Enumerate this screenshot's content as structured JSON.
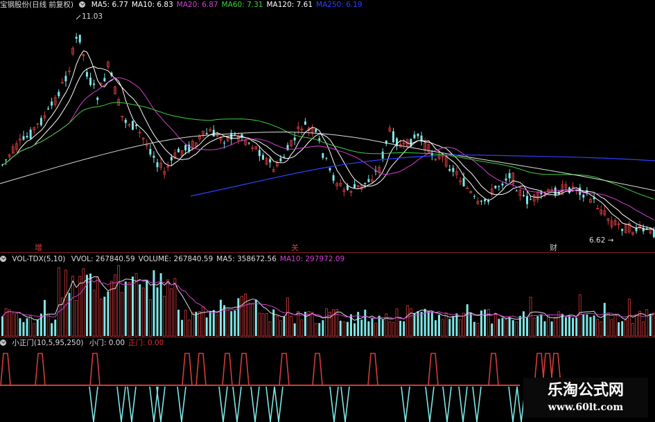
{
  "main_legend": {
    "title": "宝钢股份(日线 前复权)",
    "ma": [
      {
        "label": "MA5: 6.77",
        "color": "#ffffff"
      },
      {
        "label": "MA10: 6.83",
        "color": "#ffffff"
      },
      {
        "label": "MA20: 6.87",
        "color": "#d040d0"
      },
      {
        "label": "MA60: 7.31",
        "color": "#40d040"
      },
      {
        "label": "MA120: 7.61",
        "color": "#ffffff"
      },
      {
        "label": "MA250: 6.19",
        "color": "#3040ff"
      }
    ]
  },
  "price_high_label": "11.03",
  "price_low_label": "6.62",
  "markers": [
    {
      "text": "增",
      "color": "#d24040"
    },
    {
      "text": "关",
      "color": "#d24040"
    },
    {
      "text": "财",
      "color": "#c8c8c8"
    }
  ],
  "volume_legend": {
    "title": "VOL-TDX(5,10)",
    "items": [
      {
        "label": "VVOL: 267840.59",
        "color": "#dddddd"
      },
      {
        "label": "VOLUME: 267840.59",
        "color": "#dddddd"
      },
      {
        "label": "MA5: 358672.56",
        "color": "#dddddd"
      },
      {
        "label": "MA10: 297972.09",
        "color": "#d040d0"
      }
    ]
  },
  "indicator_legend": {
    "title": "小正门(10,5,95,250)",
    "items": [
      {
        "label": "小门: 0.00",
        "color": "#dddddd"
      },
      {
        "label": "正门: 0.00",
        "color": "#e03030"
      }
    ]
  },
  "watermark": {
    "title": "乐淘公式网",
    "url": "www.60lt.com"
  },
  "colors": {
    "up": "#d23c3c",
    "down": "#7fe6e6",
    "ma5": "#ffffff",
    "ma10": "#ffffff",
    "ma20": "#d040d0",
    "ma60": "#40d040",
    "ma120": "#e0e0e0",
    "ma250": "#3040ff"
  }
}
